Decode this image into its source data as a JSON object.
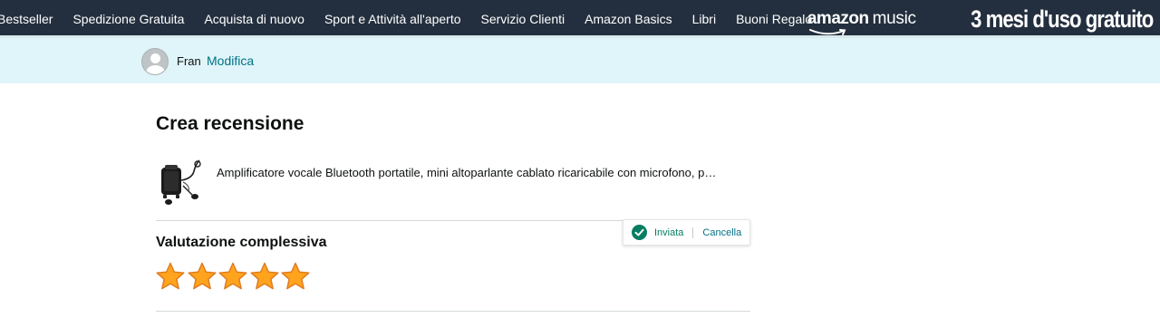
{
  "nav": {
    "links": [
      "Bestseller",
      "Spedizione Gratuita",
      "Acquista di nuovo",
      "Sport e Attività all'aperto",
      "Servizio Clienti",
      "Amazon Basics",
      "Libri",
      "Buoni Regalo"
    ],
    "music_logo_brand": "amazon",
    "music_logo_product": "music",
    "promo": "3 mesi d'uso gratuito",
    "bar_color": "#232f3e"
  },
  "profile": {
    "name": "Fran",
    "edit_label": "Modifica",
    "bar_color": "#e0f5f9"
  },
  "review": {
    "title": "Crea recensione",
    "product_title": "Amplificatore vocale Bluetooth portatile, mini altoparlante cablato ricaricabile con microfono, p…",
    "overall_label": "Valutazione complessiva",
    "rating": 5,
    "rating_max": 5,
    "star_color": "#ffa41c"
  },
  "status": {
    "sent_label": "Inviata",
    "cancel_label": "Cancella",
    "icon": "check-circle-icon",
    "color": "#067d62"
  }
}
